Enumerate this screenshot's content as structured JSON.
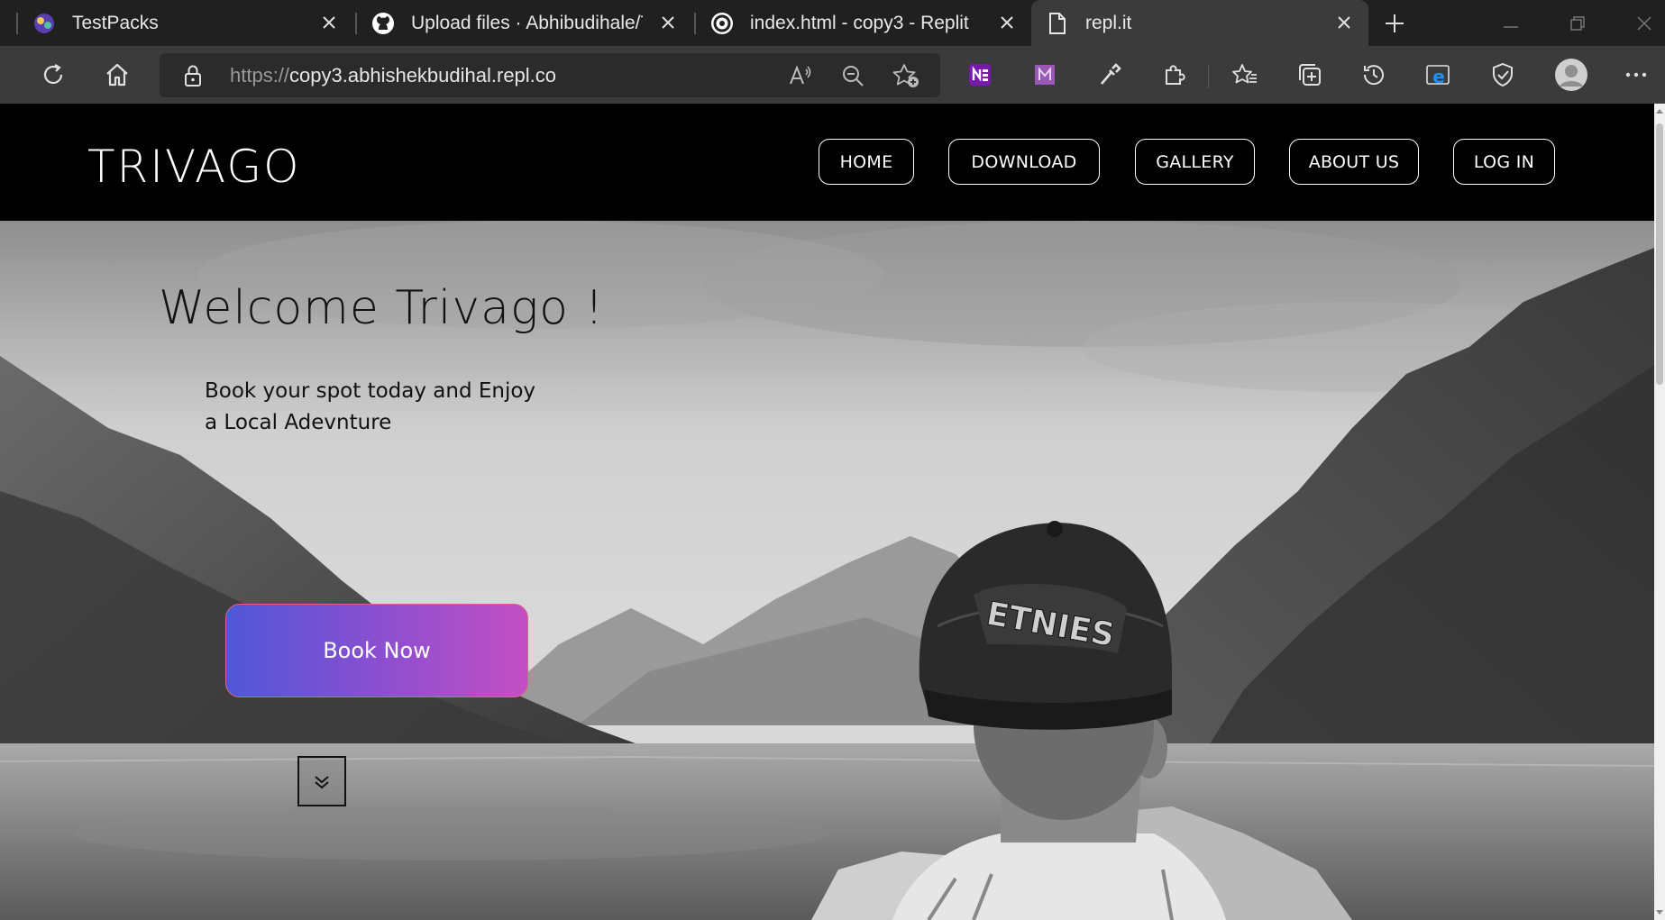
{
  "browser": {
    "tabs": [
      {
        "title": "TestPacks",
        "icon": "testpacks-icon"
      },
      {
        "title": "Upload files · Abhibudihale/Trav",
        "icon": "github-icon"
      },
      {
        "title": "index.html - copy3 - Replit",
        "icon": "replit-icon"
      },
      {
        "title": "repl.it",
        "icon": "page-icon"
      }
    ],
    "active_tab": 3,
    "url_prefix": "https://",
    "url_host": "copy3.abhishekbudihal.repl.co"
  },
  "site": {
    "brand": "TRIVAGO",
    "nav": [
      {
        "label": "HOME"
      },
      {
        "label": "DOWNLOAD"
      },
      {
        "label": "GALLERY"
      },
      {
        "label": "ABOUT US"
      },
      {
        "label": "LOG IN"
      }
    ],
    "hero": {
      "title": "Welcome Trivago !",
      "subtitle_line1": "Book your spot today and Enjoy",
      "subtitle_line2": "a Local Adevnture",
      "cta": "Book Now",
      "cap_text": "ETNIES"
    }
  },
  "colors": {
    "chrome_bg": "#202020",
    "toolbar_bg": "#3b3b3b",
    "header_bg": "#000000",
    "cta_gradient_start": "#4f57d8",
    "cta_gradient_end": "#c44fc4"
  }
}
